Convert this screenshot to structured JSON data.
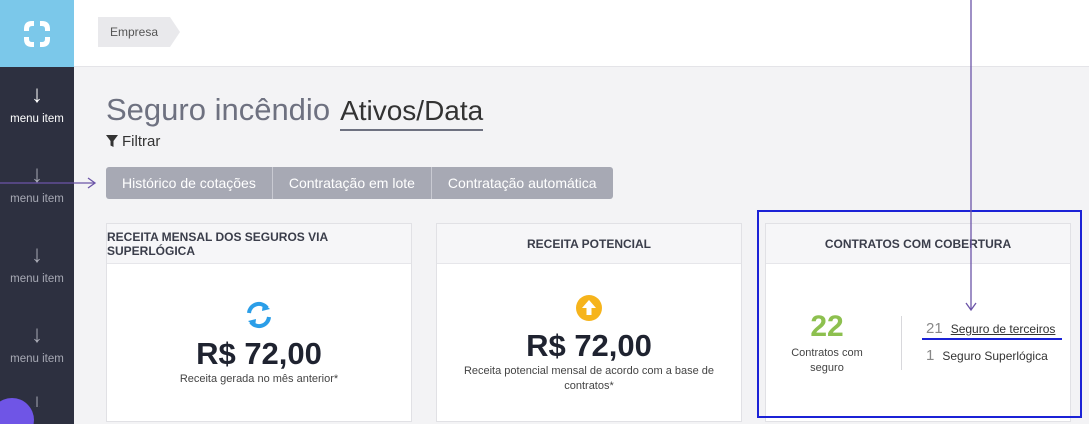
{
  "sidebar": {
    "items": [
      {
        "label": "menu item"
      },
      {
        "label": "menu item"
      },
      {
        "label": "menu item"
      },
      {
        "label": "menu item"
      }
    ]
  },
  "breadcrumb": {
    "label": "Empresa"
  },
  "header": {
    "title": "Seguro incêndio",
    "selector": "Ativos/Data",
    "filter_label": "Filtrar"
  },
  "tabs": [
    {
      "label": "Histórico de cotações"
    },
    {
      "label": "Contratação em lote"
    },
    {
      "label": "Contratação automática"
    }
  ],
  "cards": {
    "receita_mensal": {
      "title": "RECEITA MENSAL DOS SEGUROS VIA SUPERLÓGICA",
      "value": "R$ 72,00",
      "subtitle": "Receita gerada no mês anterior*"
    },
    "receita_potencial": {
      "title": "RECEITA POTENCIAL",
      "value": "R$ 72,00",
      "subtitle_line1": "Receita potencial mensal de acordo com a base de",
      "subtitle_line2": "contratos*"
    },
    "contratos": {
      "title": "CONTRATOS COM COBERTURA",
      "total": "22",
      "total_label_line1": "Contratos com",
      "total_label_line2": "seguro",
      "rows": [
        {
          "count": "21",
          "label": "Seguro de terceiros"
        },
        {
          "count": "1",
          "label": "Seguro Superlógica"
        }
      ]
    }
  },
  "colors": {
    "sidebar": "#2d3040",
    "logo_bg": "#7bc8ea",
    "tabs_bg": "#a7a9b4",
    "green": "#8dc04f",
    "highlight": "#1b22d6",
    "annotation": "#6b54a8",
    "refresh_icon": "#2b9ee8",
    "up_icon": "#f6b41c"
  },
  "icons": {
    "refresh": "refresh-icon",
    "up": "arrow-up-circle-icon",
    "filter": "filter-icon",
    "menu": "arrow-down-icon"
  }
}
